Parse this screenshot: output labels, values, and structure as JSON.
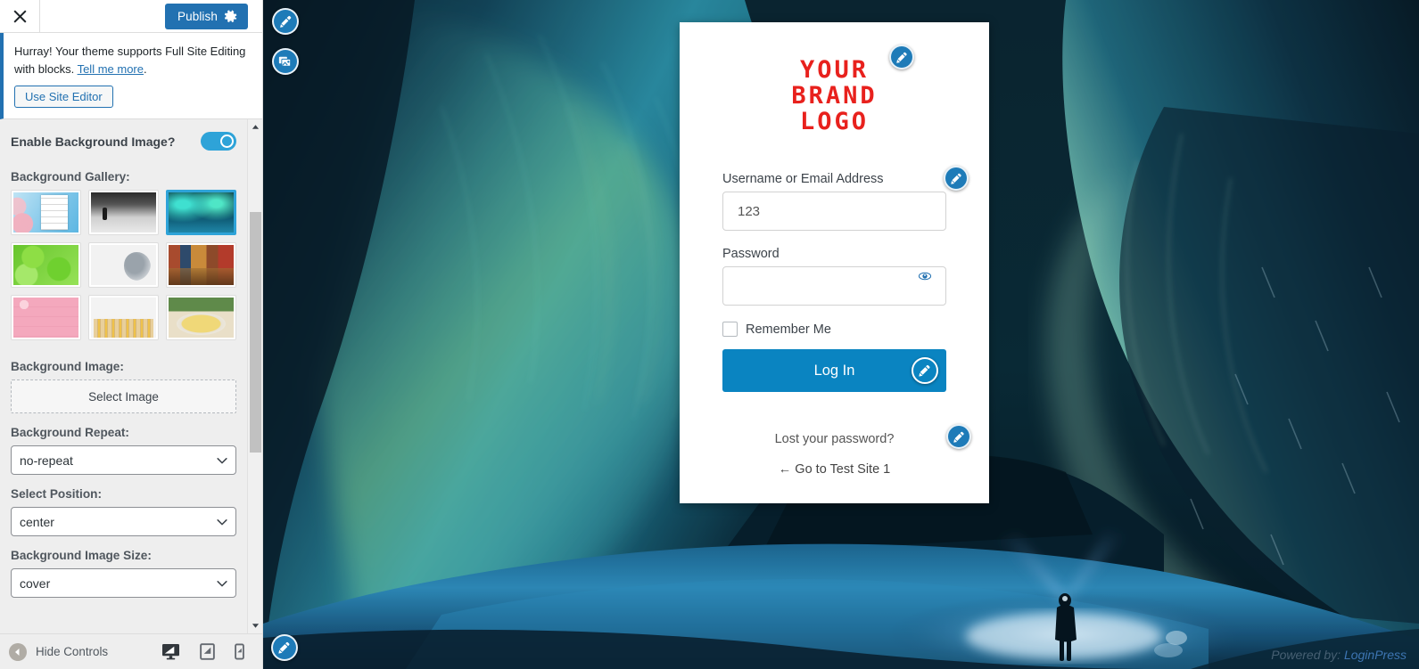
{
  "customizer": {
    "close_icon": "close-x-icon",
    "publish_label": "Publish",
    "gear_icon": "gear-icon",
    "notice": {
      "text_before": "Hurray! Your theme supports Full Site Editing with blocks. ",
      "link_label": "Tell me more",
      "text_after": ".",
      "button_label": "Use Site Editor"
    },
    "controls": {
      "enable_bg_label": "Enable Background Image?",
      "enable_bg_value": "on",
      "gallery_label": "Background Gallery:",
      "gallery_items": [
        {
          "name": "cherry-blossom-login",
          "selected": false
        },
        {
          "name": "foggy-forest-person",
          "selected": false
        },
        {
          "name": "ice-cave-aurora",
          "selected": true
        },
        {
          "name": "green-leaves",
          "selected": false
        },
        {
          "name": "grey-cat",
          "selected": false
        },
        {
          "name": "cafe-interior",
          "selected": false
        },
        {
          "name": "pink-wood-floral",
          "selected": false
        },
        {
          "name": "colored-pencils",
          "selected": false
        },
        {
          "name": "pasta-plate",
          "selected": false
        }
      ],
      "bg_image_label": "Background Image:",
      "select_image_label": "Select Image",
      "bg_repeat_label": "Background Repeat:",
      "bg_repeat_value": "no-repeat",
      "position_label": "Select Position:",
      "position_value": "center",
      "bg_size_label": "Background Image Size:",
      "bg_size_value": "cover"
    },
    "bottom": {
      "hide_controls_label": "Hide Controls",
      "devices": [
        {
          "name": "desktop-preview",
          "active": true
        },
        {
          "name": "tablet-preview",
          "active": false
        },
        {
          "name": "mobile-preview",
          "active": false
        }
      ]
    }
  },
  "preview": {
    "floating_icons": [
      {
        "name": "brush-edit-icon"
      },
      {
        "name": "media-edit-icon"
      },
      {
        "name": "pencil-edit-icon"
      }
    ],
    "login": {
      "logo_lines": [
        "YOUR",
        "BRAND",
        "LOGO"
      ],
      "username_label": "Username or Email Address",
      "username_value": "123",
      "password_label": "Password",
      "password_value": "",
      "remember_label": "Remember Me",
      "login_button_label": "Log In",
      "lost_password_label": "Lost your password?",
      "back_to_site_label": "← Go to Test Site 1"
    },
    "powered_by_prefix": "Powered by: ",
    "powered_by_brand": "LoginPress"
  },
  "colors": {
    "wp_blue": "#2271b1",
    "toggle_blue": "#2ea3d8",
    "login_button": "#0a84c1",
    "brand_red": "#e8211d",
    "sidebar_bg": "#eeeeee"
  }
}
